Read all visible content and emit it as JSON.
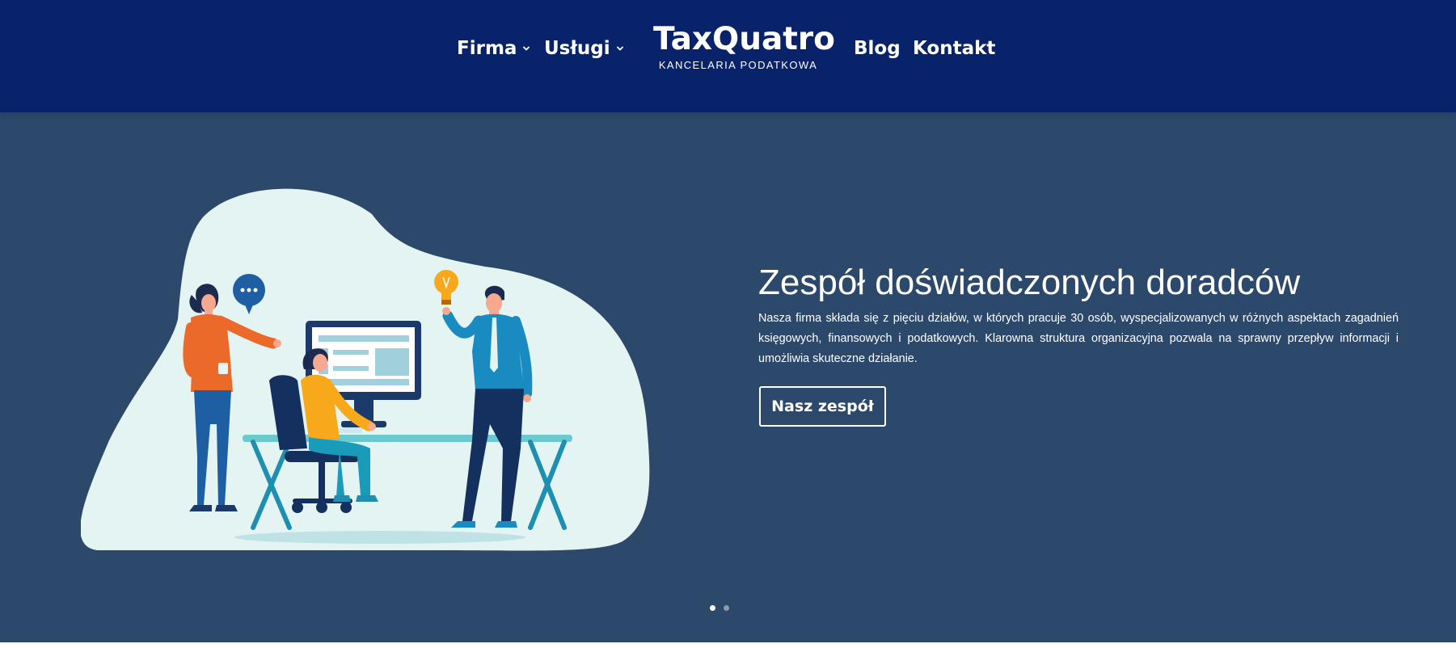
{
  "nav": {
    "items": [
      {
        "label": "Firma",
        "dropdown": true
      },
      {
        "label": "Usługi",
        "dropdown": true
      },
      {
        "label": "Blog",
        "dropdown": false
      },
      {
        "label": "Kontakt",
        "dropdown": false
      }
    ]
  },
  "logo": {
    "title": "TaxQuatro",
    "subtitle": "KANCELARIA PODATKOWA"
  },
  "hero": {
    "title": "Zespół doświadczonych doradców",
    "text": "Nasza firma składa się z pięciu działów, w których pracuje 30 osób, wyspecjalizowanych w różnych aspektach zagadnień księgowych, finansowych i podatkowych. Klarowna struktura organizacyjna pozwala na sprawny przepływ informacji i umożliwia skuteczne działanie.",
    "button_label": "Nasz zespół"
  },
  "slider": {
    "active_index": 0,
    "count": 2
  },
  "colors": {
    "header_bg": "#08236a",
    "hero_bg": "#2c486b",
    "blob": "#e3f4f3",
    "text": "#ffffff"
  },
  "icons": {
    "nav_dropdown": "chevron-down-icon",
    "speech": "speech-bubble-icon",
    "idea": "lightbulb-icon"
  }
}
